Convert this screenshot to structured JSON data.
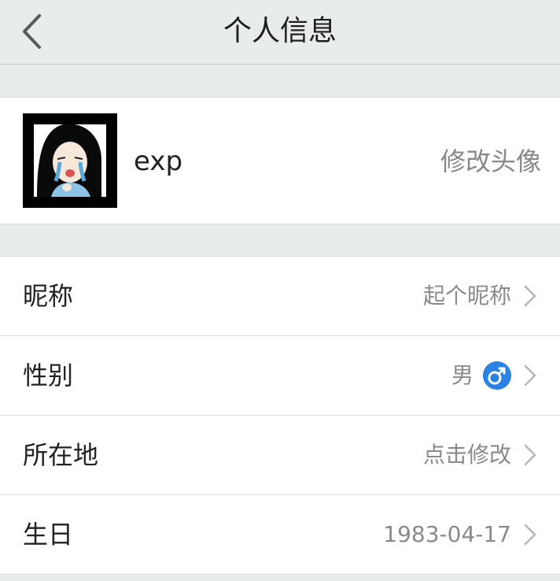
{
  "header": {
    "title": "个人信息"
  },
  "profile": {
    "name": "exp",
    "change_avatar": "修改头像"
  },
  "rows": [
    {
      "label": "昵称",
      "value": "起个昵称"
    },
    {
      "label": "性别",
      "value": "男",
      "icon": "male-icon",
      "icon_color": "#2a82e4"
    },
    {
      "label": "所在地",
      "value": "点击修改"
    },
    {
      "label": "生日",
      "value": "1983-04-17"
    }
  ],
  "icons": {
    "back": "back-chevron-icon",
    "row_chevron": "chevron-right-icon"
  }
}
